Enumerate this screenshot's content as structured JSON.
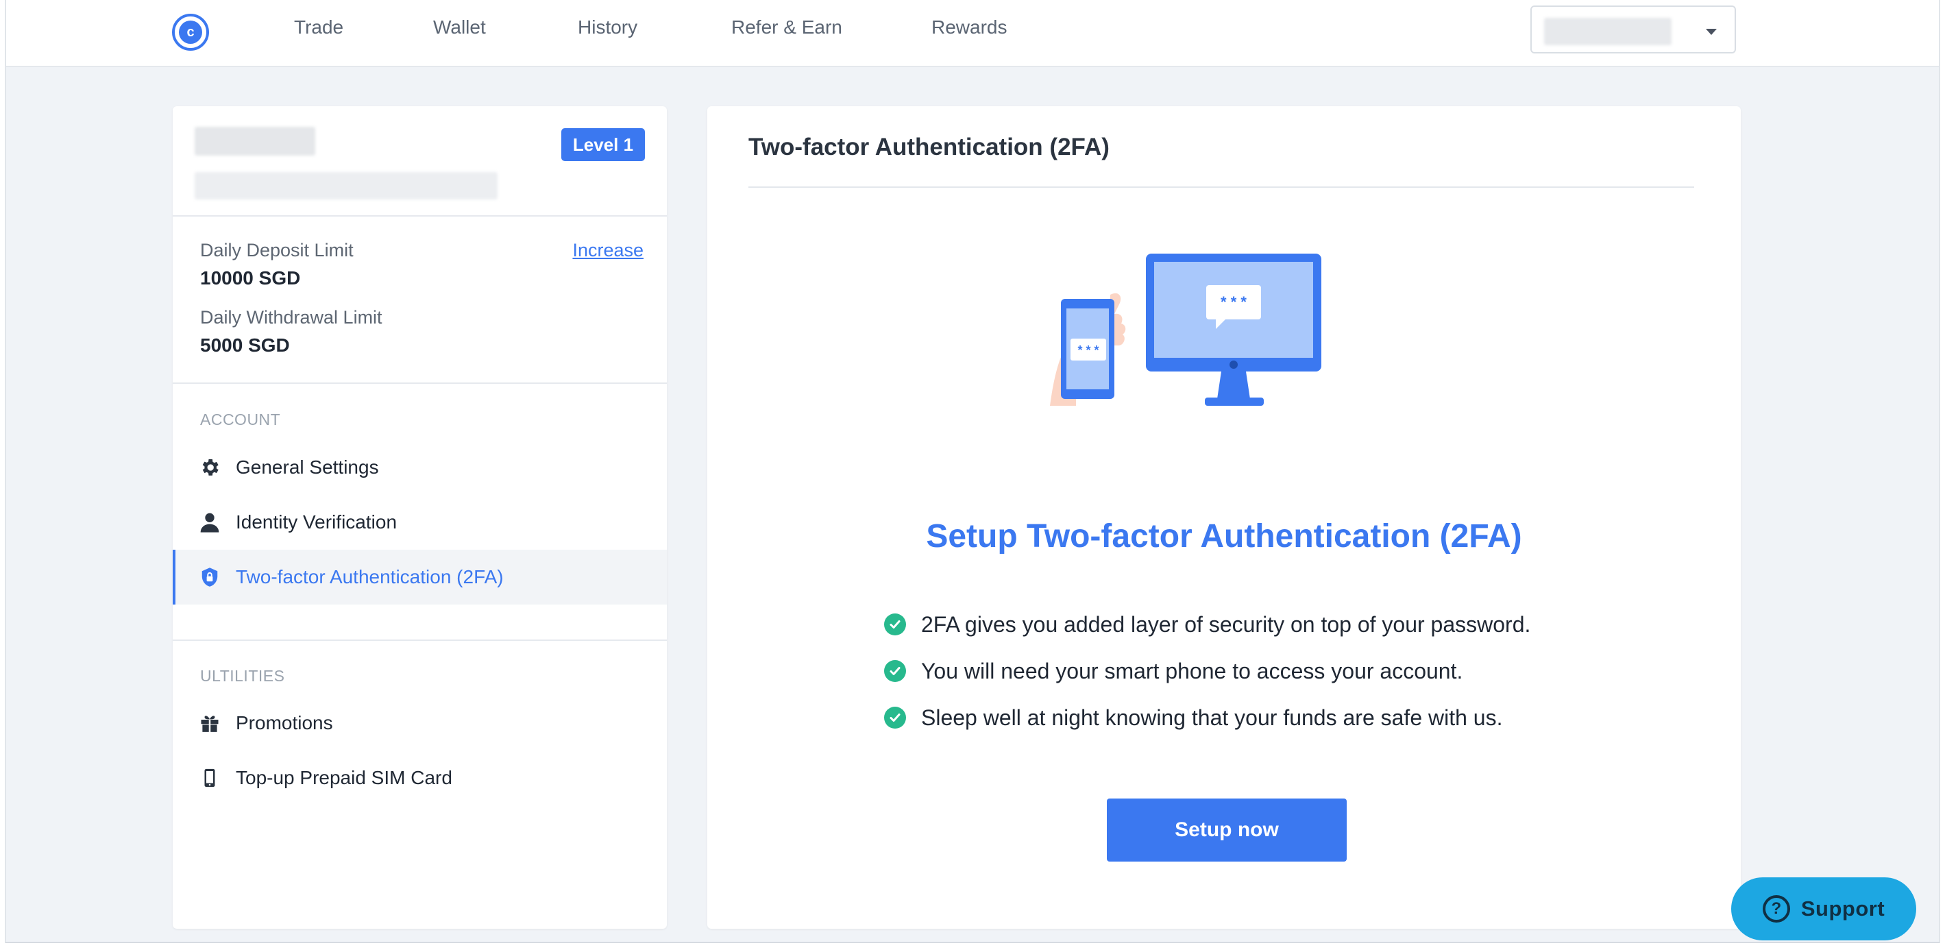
{
  "nav": {
    "logo_letter": "c",
    "links": [
      "Trade",
      "Wallet",
      "History",
      "Refer & Earn",
      "Rewards"
    ]
  },
  "profile": {
    "level_badge": "Level 1"
  },
  "limits": {
    "deposit_label": "Daily Deposit Limit",
    "deposit_value": "10000 SGD",
    "increase_link": "Increase",
    "withdrawal_label": "Daily Withdrawal Limit",
    "withdrawal_value": "5000 SGD"
  },
  "sidebar": {
    "account_heading": "ACCOUNT",
    "account_items": [
      {
        "label": "General Settings",
        "icon": "gear-icon"
      },
      {
        "label": "Identity Verification",
        "icon": "person-icon"
      },
      {
        "label": "Two-factor Authentication (2FA)",
        "icon": "shield-lock-icon",
        "active": true
      }
    ],
    "utilities_heading": "ULTILITIES",
    "utility_items": [
      {
        "label": "Promotions",
        "icon": "gift-icon"
      },
      {
        "label": "Top-up Prepaid SIM Card",
        "icon": "mobile-phone-icon"
      }
    ]
  },
  "main": {
    "title": "Two-factor Authentication (2FA)",
    "illustration_message": "* * *",
    "heading": "Setup Two-factor Authentication (2FA)",
    "benefits": [
      "2FA gives you added layer of security on top of your password.",
      "You will need your smart phone to access your account.",
      "Sleep well at night knowing that your funds are safe with us."
    ],
    "setup_button": "Setup now"
  },
  "support": {
    "label": "Support",
    "icon_glyph": "?"
  },
  "colors": {
    "accent": "#3b78f0",
    "check": "#27b98d",
    "support": "#1da7e2"
  }
}
